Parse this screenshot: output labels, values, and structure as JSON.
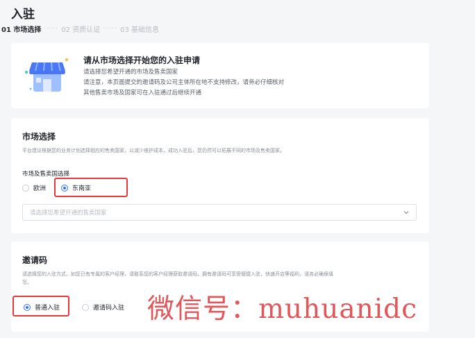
{
  "page": {
    "title": "入驻"
  },
  "steps": [
    {
      "label": "01 市场选择",
      "active": true
    },
    {
      "label": "02 资质认证",
      "active": false
    },
    {
      "label": "03 基础信息",
      "active": false
    }
  ],
  "steps_separator": "·····",
  "intro": {
    "title": "请从市场选择开始您的入驻申请",
    "lines": [
      "请选择您希望开通的市场及售卖国家",
      "请注意，本页面提交的邀请码及公司主体所在地不支持修改，请务必仔细核对",
      "其他售卖市场及国家可在入驻通过后继续开通"
    ]
  },
  "market": {
    "title": "市场选择",
    "description": "平台建议根据您的业务计划选择相应的售卖国家，以减少维护成本，成功入驻后，您仍然可以拓展不同的市场及售卖国家。",
    "field_label": "市场及售卖国选择",
    "options": [
      {
        "label": "欧洲",
        "checked": false
      },
      {
        "label": "东南亚",
        "checked": true
      }
    ],
    "select_placeholder": "请选择您希望开通的售卖国家"
  },
  "invite": {
    "title": "邀请码",
    "description_line1": "请选择您的入驻方式，如您已有专属的客户经理，请联系您的客户经理获取邀请码，拥有邀请码可享受便捷入驻，快速开店等福利，请务必确保填",
    "description_line2": "写。",
    "options": [
      {
        "label": "普通入驻",
        "checked": true
      },
      {
        "label": "邀请码入驻",
        "checked": false
      }
    ]
  },
  "watermark": "微信号：muhuanidc",
  "colors": {
    "accent": "#3370ff",
    "highlight": "#e8373b",
    "watermark": "#e2565a"
  }
}
